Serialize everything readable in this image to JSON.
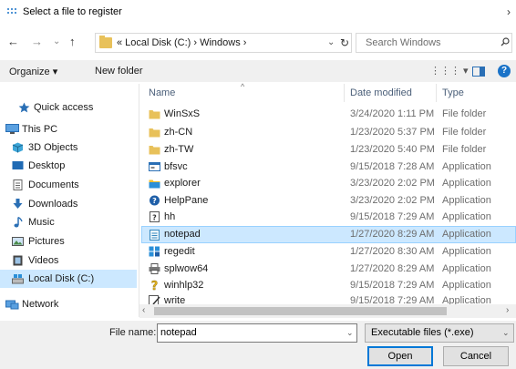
{
  "window": {
    "title": "Select a file to register",
    "close_glyph": "›"
  },
  "nav": {
    "back": "←",
    "forward": "→",
    "recent": "⌄",
    "up": "↑",
    "address": "«  Local Disk (C:)  ›  Windows  ›",
    "address_dropdown": "⌄",
    "refresh": "↻",
    "search_placeholder": "Search Windows"
  },
  "toolbar": {
    "organize": "Organize ▾",
    "new_folder": "New folder",
    "view": "⋮⋮⋮ ▾",
    "help": "?"
  },
  "sidebar": {
    "items": [
      {
        "label": "Quick access",
        "icon": "star-icon"
      },
      {
        "label": "This PC",
        "icon": "computer-icon"
      },
      {
        "label": "3D Objects",
        "icon": "cube-icon"
      },
      {
        "label": "Desktop",
        "icon": "desktop-icon"
      },
      {
        "label": "Documents",
        "icon": "document-icon"
      },
      {
        "label": "Downloads",
        "icon": "download-icon"
      },
      {
        "label": "Music",
        "icon": "music-icon"
      },
      {
        "label": "Pictures",
        "icon": "pictures-icon"
      },
      {
        "label": "Videos",
        "icon": "video-icon"
      },
      {
        "label": "Local Disk (C:)",
        "icon": "disk-icon"
      },
      {
        "label": "Network",
        "icon": "network-icon"
      }
    ]
  },
  "list": {
    "columns": {
      "name": "Name",
      "date": "Date modified",
      "type": "Type",
      "sort_indicator": "^"
    },
    "rows": [
      {
        "name": "WinSxS",
        "date": "3/24/2020 1:11 PM",
        "type": "File folder",
        "icon": "folder-icon"
      },
      {
        "name": "zh-CN",
        "date": "1/23/2020 5:37 PM",
        "type": "File folder",
        "icon": "folder-icon"
      },
      {
        "name": "zh-TW",
        "date": "1/23/2020 5:40 PM",
        "type": "File folder",
        "icon": "folder-icon"
      },
      {
        "name": "bfsvc",
        "date": "9/15/2018 7:28 AM",
        "type": "Application",
        "icon": "app-window-icon"
      },
      {
        "name": "explorer",
        "date": "3/23/2020 2:02 PM",
        "type": "Application",
        "icon": "explorer-icon"
      },
      {
        "name": "HelpPane",
        "date": "3/23/2020 2:02 PM",
        "type": "Application",
        "icon": "help-icon"
      },
      {
        "name": "hh",
        "date": "9/15/2018 7:29 AM",
        "type": "Application",
        "icon": "help-file-icon"
      },
      {
        "name": "notepad",
        "date": "1/27/2020 8:29 AM",
        "type": "Application",
        "icon": "notepad-icon"
      },
      {
        "name": "regedit",
        "date": "1/27/2020 8:30 AM",
        "type": "Application",
        "icon": "regedit-icon"
      },
      {
        "name": "splwow64",
        "date": "1/27/2020 8:29 AM",
        "type": "Application",
        "icon": "printer-icon"
      },
      {
        "name": "winhlp32",
        "date": "9/15/2018 7:29 AM",
        "type": "Application",
        "icon": "question-icon"
      },
      {
        "name": "write",
        "date": "9/15/2018 7:29 AM",
        "type": "Application",
        "icon": "write-icon"
      }
    ],
    "selected_index": 7
  },
  "scroll": {
    "left": "‹",
    "right": "›"
  },
  "footer": {
    "file_name_label": "File name:",
    "file_name_value": "notepad",
    "file_type_value": "Executable files (*.exe)",
    "dropdown_glyph": "⌄",
    "open_label": "Open",
    "cancel_label": "Cancel"
  },
  "colors": {
    "selection": "#cce8ff",
    "folder": "#e8c15a",
    "accent": "#0078d7"
  }
}
